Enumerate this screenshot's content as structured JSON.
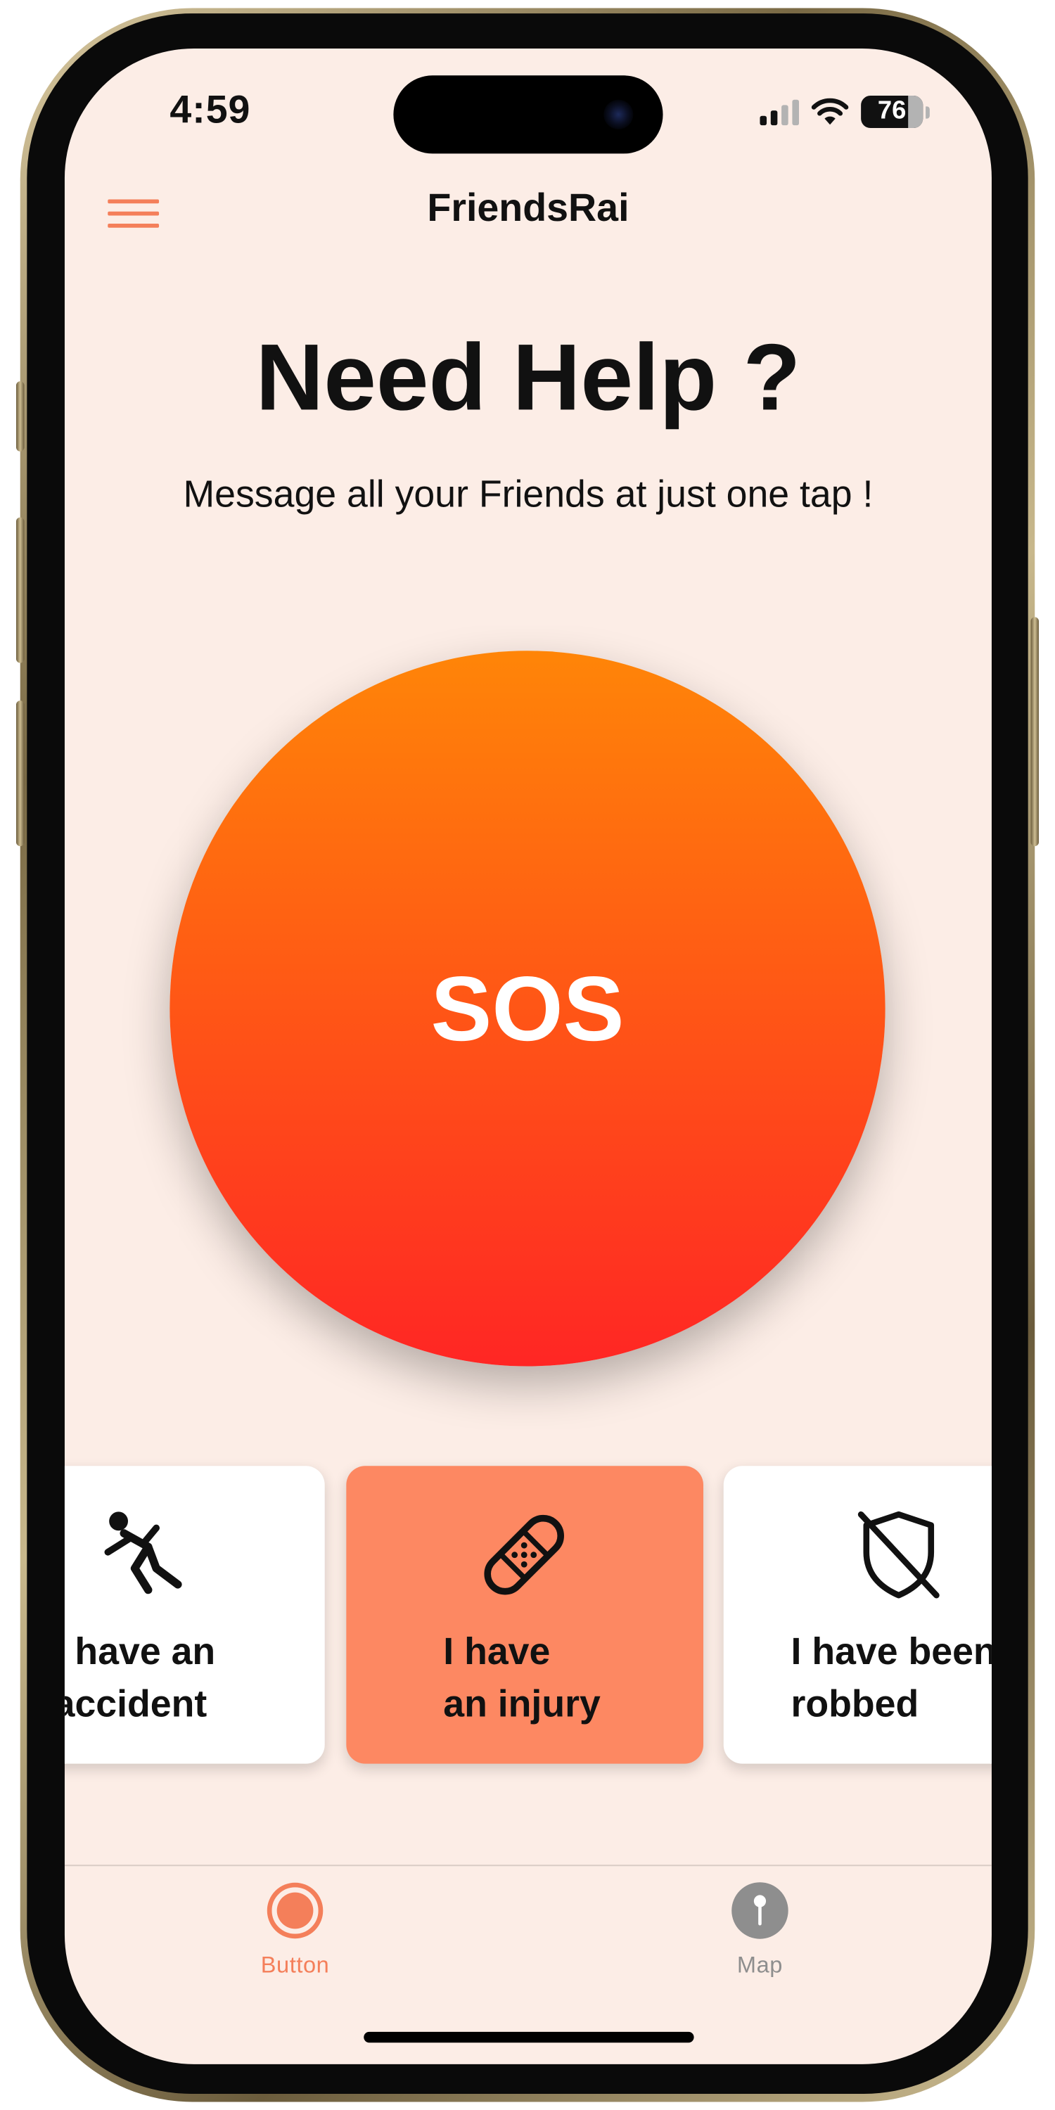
{
  "status_bar": {
    "time": "4:59",
    "battery_level": "76"
  },
  "header": {
    "title": "FriendsRai",
    "menu_icon": "hamburger-menu-icon"
  },
  "hero": {
    "headline": "Need Help ?",
    "subline": "Message all your Friends at just one tap !"
  },
  "sos_button": {
    "label": "SOS"
  },
  "cards": [
    {
      "icon": "person-falling-icon",
      "line1": "I have an",
      "line2": "accident",
      "active": false
    },
    {
      "icon": "bandage-icon",
      "line1": "I have",
      "line2": "an injury",
      "active": true
    },
    {
      "icon": "shield-slash-icon",
      "line1": "I have been",
      "line2": "robbed",
      "active": false
    }
  ],
  "tab_bar": {
    "tabs": [
      {
        "label": "Button",
        "icon": "record-circle-icon",
        "selected": true
      },
      {
        "label": "Map",
        "icon": "map-pin-icon",
        "selected": false
      }
    ]
  },
  "colors": {
    "background": "#fcede6",
    "accent": "#f47f5a",
    "sos_top": "#ff8508",
    "sos_bottom": "#ff2624",
    "card_active": "#fd8862",
    "tab_inactive": "#8e8e8e"
  }
}
